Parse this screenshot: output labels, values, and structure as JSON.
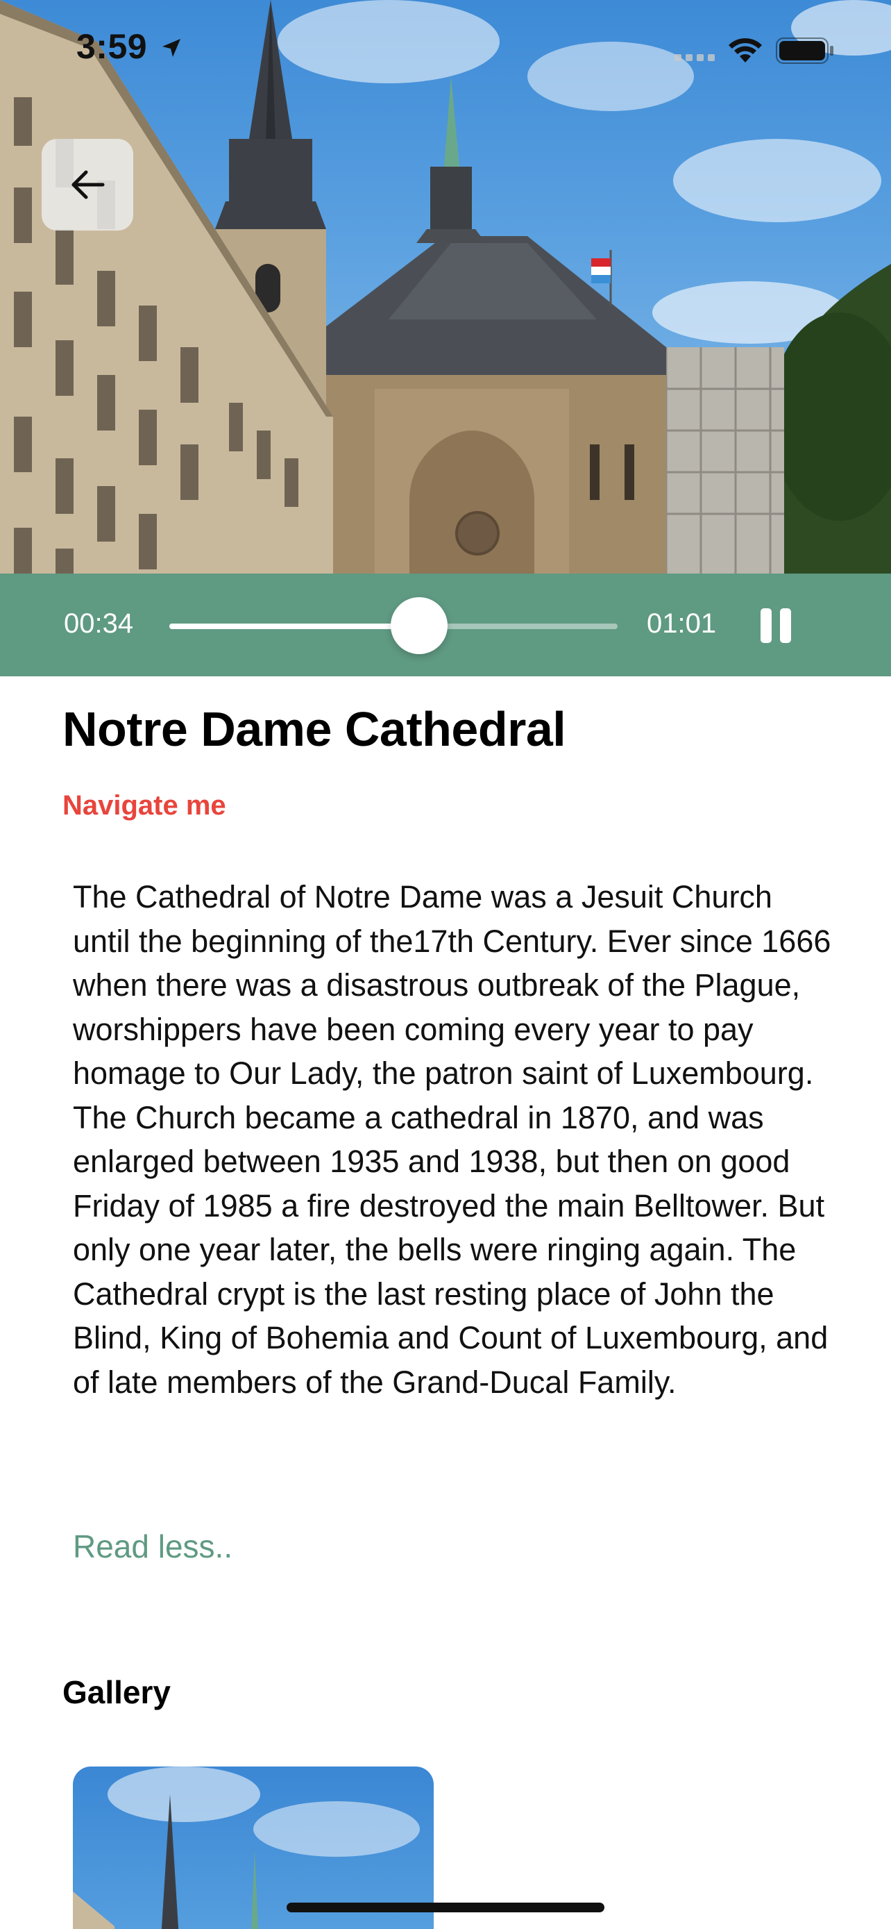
{
  "status_bar": {
    "time": "3:59",
    "icons": [
      "location-arrow-icon",
      "cellular-signal-icon",
      "wifi-icon",
      "battery-icon"
    ]
  },
  "hero": {
    "image": "cathedral-photo",
    "back_icon": "arrow-left-icon"
  },
  "player": {
    "elapsed": "00:34",
    "total": "01:01",
    "progress": 0.557,
    "control_icon": "pause-icon",
    "background_color": "#5f9a82"
  },
  "content": {
    "title": "Notre Dame Cathedral",
    "navigate_label": "Navigate me",
    "navigate_color": "#e8453c",
    "description": "The Cathedral of Notre Dame was a Jesuit Church until the beginning of the17th Century. Ever since 1666 when there was a disastrous outbreak of the Plague, worshippers have been coming every year to pay homage to Our Lady, the patron saint of Luxembourg. The Church became a cathedral in 1870, and was enlarged between 1935 and 1938, but then on good Friday of 1985 a fire destroyed the main Belltower. But only one year later, the bells were ringing again. The Cathedral crypt is the last resting place of John the Blind, King of Bohemia and Count of Luxembourg, and of late members of the Grand-Ducal Family.",
    "read_less_label": "Read less..",
    "accent_color": "#5f9a82"
  },
  "gallery": {
    "heading": "Gallery",
    "items": [
      "cathedral-photo"
    ]
  }
}
